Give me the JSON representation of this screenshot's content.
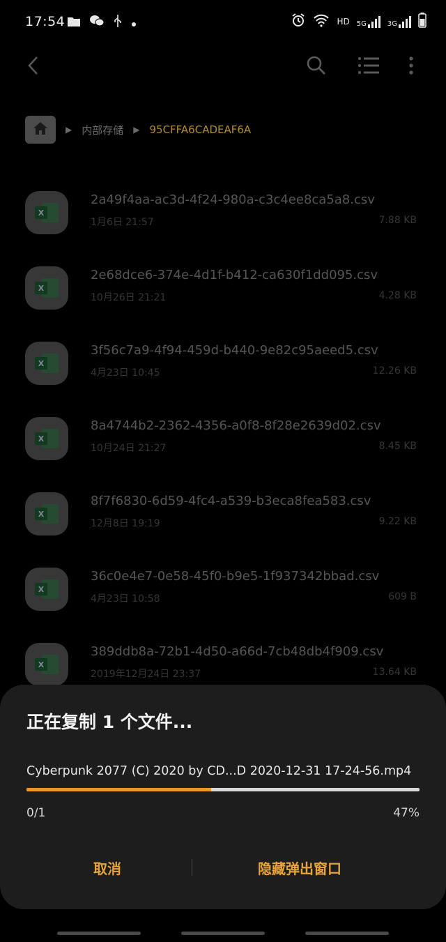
{
  "status_bar": {
    "time": "17:54",
    "network_labels": [
      "HD",
      "5G",
      "3G"
    ]
  },
  "toolbar": {
    "back_icon": "back-arrow-icon",
    "search_icon": "search-icon",
    "view_icon": "list-view-icon",
    "more_icon": "more-vert-icon"
  },
  "breadcrumb": {
    "home_icon": "home-icon",
    "parent": "内部存储",
    "current": "95CFFA6CADEAF6A"
  },
  "files": [
    {
      "name": "2a49f4aa-ac3d-4f24-980a-c3c4ee8ca5a8.csv",
      "date": "1月6日 21:57",
      "size": "7.88 KB",
      "icon": "excel-file-icon"
    },
    {
      "name": "2e68dce6-374e-4d1f-b412-ca630f1dd095.csv",
      "date": "10月26日 21:21",
      "size": "4.28 KB",
      "icon": "excel-file-icon"
    },
    {
      "name": "3f56c7a9-4f94-459d-b440-9e82c95aeed5.csv",
      "date": "4月23日 10:45",
      "size": "12.26 KB",
      "icon": "excel-file-icon"
    },
    {
      "name": "8a4744b2-2362-4356-a0f8-8f28e2639d02.csv",
      "date": "10月24日 21:27",
      "size": "8.45 KB",
      "icon": "excel-file-icon"
    },
    {
      "name": "8f7f6830-6d59-4fc4-a539-b3eca8fea583.csv",
      "date": "12月8日 19:19",
      "size": "9.22 KB",
      "icon": "excel-file-icon"
    },
    {
      "name": "36c0e4e7-0e58-45f0-b9e5-1f937342bbad.csv",
      "date": "4月23日 10:58",
      "size": "609 B",
      "icon": "excel-file-icon"
    },
    {
      "name": "389ddb8a-72b1-4d50-a66d-7cb48db4f909.csv",
      "date": "2019年12月24日 23:37",
      "size": "13.64 KB",
      "icon": "excel-file-icon"
    }
  ],
  "dialog": {
    "title": "正在复制 1 个文件...",
    "file_name": "Cyberpunk 2077 (C) 2020 by CD...D 2020-12-31 17-24-56.mp4",
    "progress_fraction": 0.47,
    "count": "0/1",
    "percent": "47%",
    "cancel_label": "取消",
    "hide_label": "隐藏弹出窗口",
    "accent_color": "#e8a33a",
    "progress_color": "#e89a25"
  }
}
